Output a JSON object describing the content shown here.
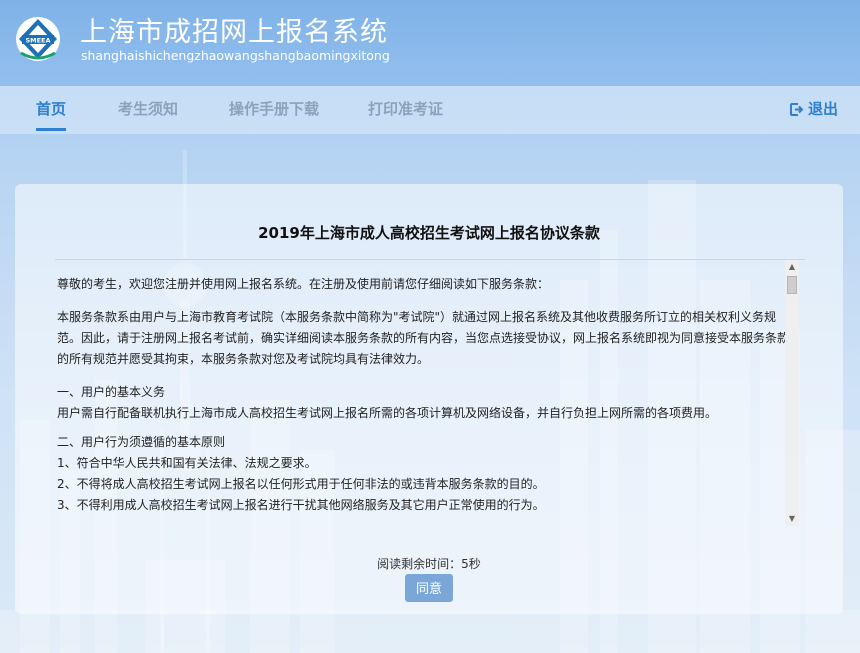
{
  "header": {
    "title": "上海市成招网上报名系统",
    "subtitle": "shanghaishichengzhaowangshangbaomingxitong",
    "logo_text": "SMEEA"
  },
  "nav": {
    "items": [
      {
        "label": "首页",
        "active": true
      },
      {
        "label": "考生须知",
        "active": false
      },
      {
        "label": "操作手册下载",
        "active": false
      },
      {
        "label": "打印准考证",
        "active": false
      }
    ],
    "logout_label": "退出",
    "logout_icon": "logout-icon"
  },
  "agreement": {
    "title": "2019年上海市成人高校招生考试网上报名协议条款",
    "greeting": "尊敬的考生，欢迎您注册并使用网上报名系统。在注册及使用前请您仔细阅读如下服务条款：",
    "intro": "本服务条款系由用户与上海市教育考试院（本服务条款中简称为\"考试院\"）就通过网上报名系统及其他收费服务所订立的相关权利义务规范。因此，请于注册网上报名考试前，确实详细阅读本服务条款的所有内容，当您点选接受协议，网上报名系统即视为同意接受本服务条款的所有规范并愿受其拘束，本服务条款对您及考试院均具有法律效力。",
    "section1_title": "一、用户的基本义务",
    "section1_text": "用户需自行配备联机执行上海市成人高校招生考试网上报名所需的各项计算机及网络设备，并自行负担上网所需的各项费用。",
    "section2_title": "二、用户行为须遵循的基本原则",
    "section2_items": [
      "1、符合中华人民共和国有关法律、法规之要求。",
      "2、不得将成人高校招生考试网上报名以任何形式用于任何非法的或违背本服务条款的目的。",
      "3、不得利用成人高校招生考试网上报名进行干扰其他网络服务及其它用户正常使用的行为。"
    ]
  },
  "timer_text": "阅读剩余时间：5秒",
  "agree_label": "同意",
  "colors": {
    "accent": "#2f7fd0",
    "header_bg": "#86b8ea",
    "button_bg": "#7aa7d8"
  }
}
